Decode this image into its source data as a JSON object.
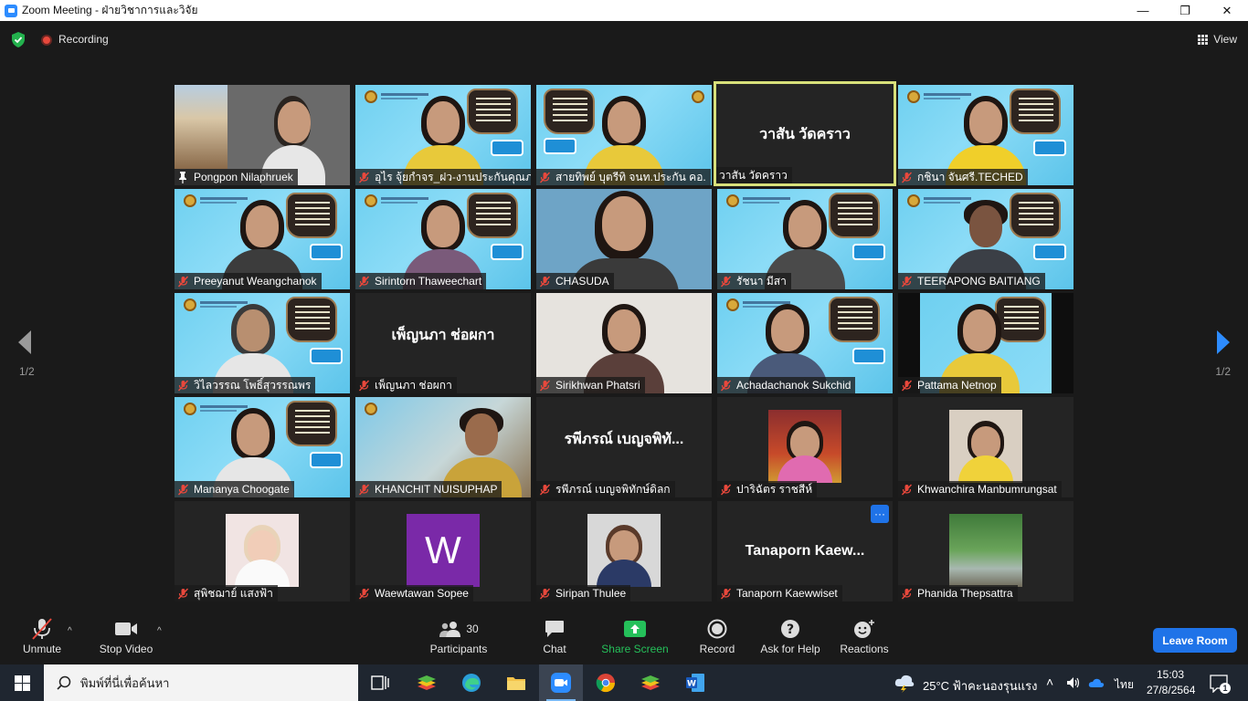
{
  "window": {
    "title": "Zoom Meeting - ฝ่ายวิชาการและวิจัย",
    "minimize": "—",
    "maximize": "❐",
    "close": "✕"
  },
  "topbar": {
    "recording_label": "Recording",
    "view_label": "View"
  },
  "pagination": {
    "left": "1/2",
    "right": "1/2"
  },
  "tiles": [
    {
      "name": "Pongpon Nilaphruek"
    },
    {
      "name": "อุไร จุ้ยกำจร_ฝว-งานประกันคุณภาพ"
    },
    {
      "name": "สายทิพย์  บุตรีทิ จนท.ประกัน คอ."
    },
    {
      "name": "วาสัน  วัดคราว",
      "center": "วาสัน  วัดคราว"
    },
    {
      "name": "กชินา  จันศรี.TECHED"
    },
    {
      "name": "Preeyanut Weangchanok"
    },
    {
      "name": "Sirintorn Thaweechart"
    },
    {
      "name": "CHASUDA"
    },
    {
      "name": "รัชนา มีสา"
    },
    {
      "name": "TEERAPONG  BAITIANG"
    },
    {
      "name": "วิไลวรรณ โพธิ์สุวรรณพร"
    },
    {
      "name": "เพ็ญนภา ช่อผกา",
      "center": "เพ็ญนภา ช่อผกา"
    },
    {
      "name": "Sirikhwan Phatsri"
    },
    {
      "name": "Achadachanok Sukchid"
    },
    {
      "name": "Pattama Netnop"
    },
    {
      "name": "Mananya Choogate"
    },
    {
      "name": "KHANCHIT NUISUPHAP"
    },
    {
      "name": "รพีภรณ์ เบญจพิทักษ์ดิลก",
      "center": "รพีภรณ์ เบญจพิทั..."
    },
    {
      "name": "ปาริฉัตร  ราชสีห์"
    },
    {
      "name": "Khwanchira Manbumrungsat"
    },
    {
      "name": "สุพิชฌาย์ แสงฟ้า"
    },
    {
      "name": "Waewtawan Sopee",
      "avatar_letter": "W"
    },
    {
      "name": "Siripan Thulee"
    },
    {
      "name": "Tanaporn Kaewwiset",
      "center": "Tanaporn  Kaew...",
      "more": "···"
    },
    {
      "name": "Phanida Thepsattra"
    }
  ],
  "toolbar": {
    "unmute": "Unmute",
    "stop_video": "Stop Video",
    "participants": "Participants",
    "participants_count": "30",
    "chat": "Chat",
    "share_screen": "Share Screen",
    "record": "Record",
    "ask_for_help": "Ask for Help",
    "reactions": "Reactions",
    "leave_room": "Leave Room",
    "caret": "^"
  },
  "taskbar": {
    "search_placeholder": "พิมพ์ที่นี่เพื่อค้นหา",
    "weather": "25°C  ฟ้าคะนองรุนแรง",
    "lang": "ไทย",
    "time": "15:03",
    "date": "27/8/2564",
    "notifications": "1"
  },
  "colors": {
    "accent": "#1f73e8",
    "share_green": "#25c05a",
    "muted_red": "#e8483c",
    "speaker_border": "#d8e07a"
  }
}
